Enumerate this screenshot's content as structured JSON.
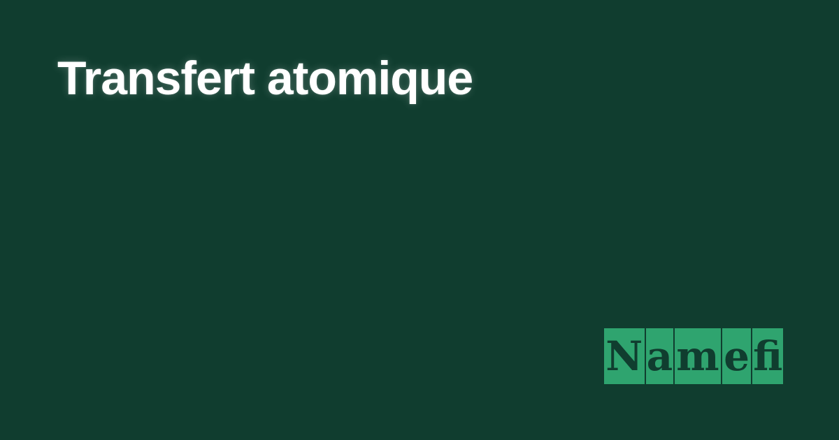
{
  "page": {
    "title": "Transfert atomique",
    "background_color": "#103D2F",
    "title_color": "#FFFFFF"
  },
  "logo": {
    "text": "Namefi",
    "letters": [
      "N",
      "a",
      "m",
      "e",
      "fi"
    ],
    "tile_color": "#2FA46F",
    "text_color": "#103D2F"
  }
}
